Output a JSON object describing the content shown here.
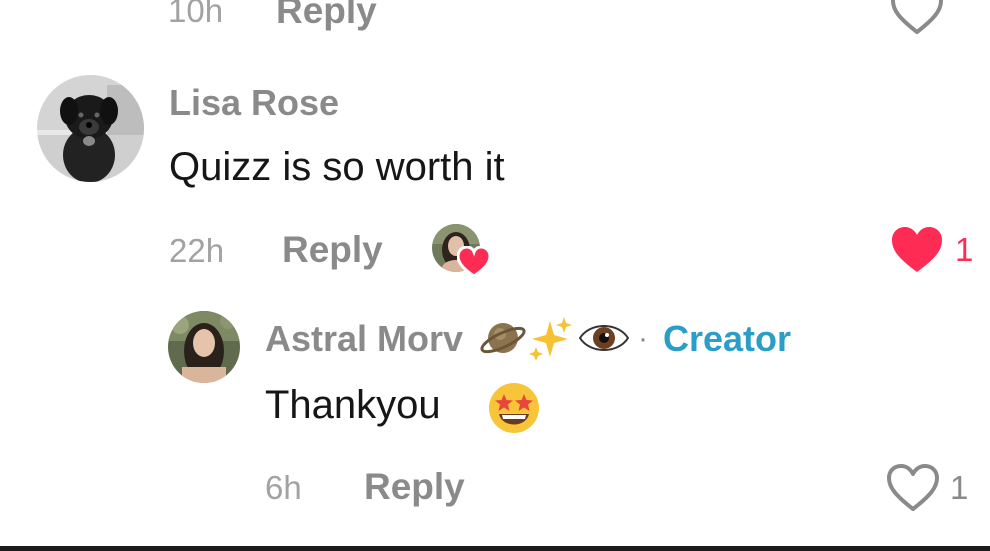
{
  "top_comment": {
    "time": "10h",
    "reply_label": "Reply"
  },
  "comment": {
    "username": "Lisa Rose",
    "text": "Quizz is so worth it",
    "time": "22h",
    "reply_label": "Reply",
    "like_count": "1",
    "liked": true,
    "like_color": "#fe2c55"
  },
  "reply": {
    "username": "Astral Morv",
    "username_emojis": [
      "ringed-planet",
      "sparkles",
      "eye"
    ],
    "separator": "·",
    "badge": "Creator",
    "badge_color": "#2a9ec7",
    "text": "Thankyou",
    "text_emoji": "star-struck",
    "time": "6h",
    "reply_label": "Reply",
    "like_count": "1",
    "liked": false
  }
}
